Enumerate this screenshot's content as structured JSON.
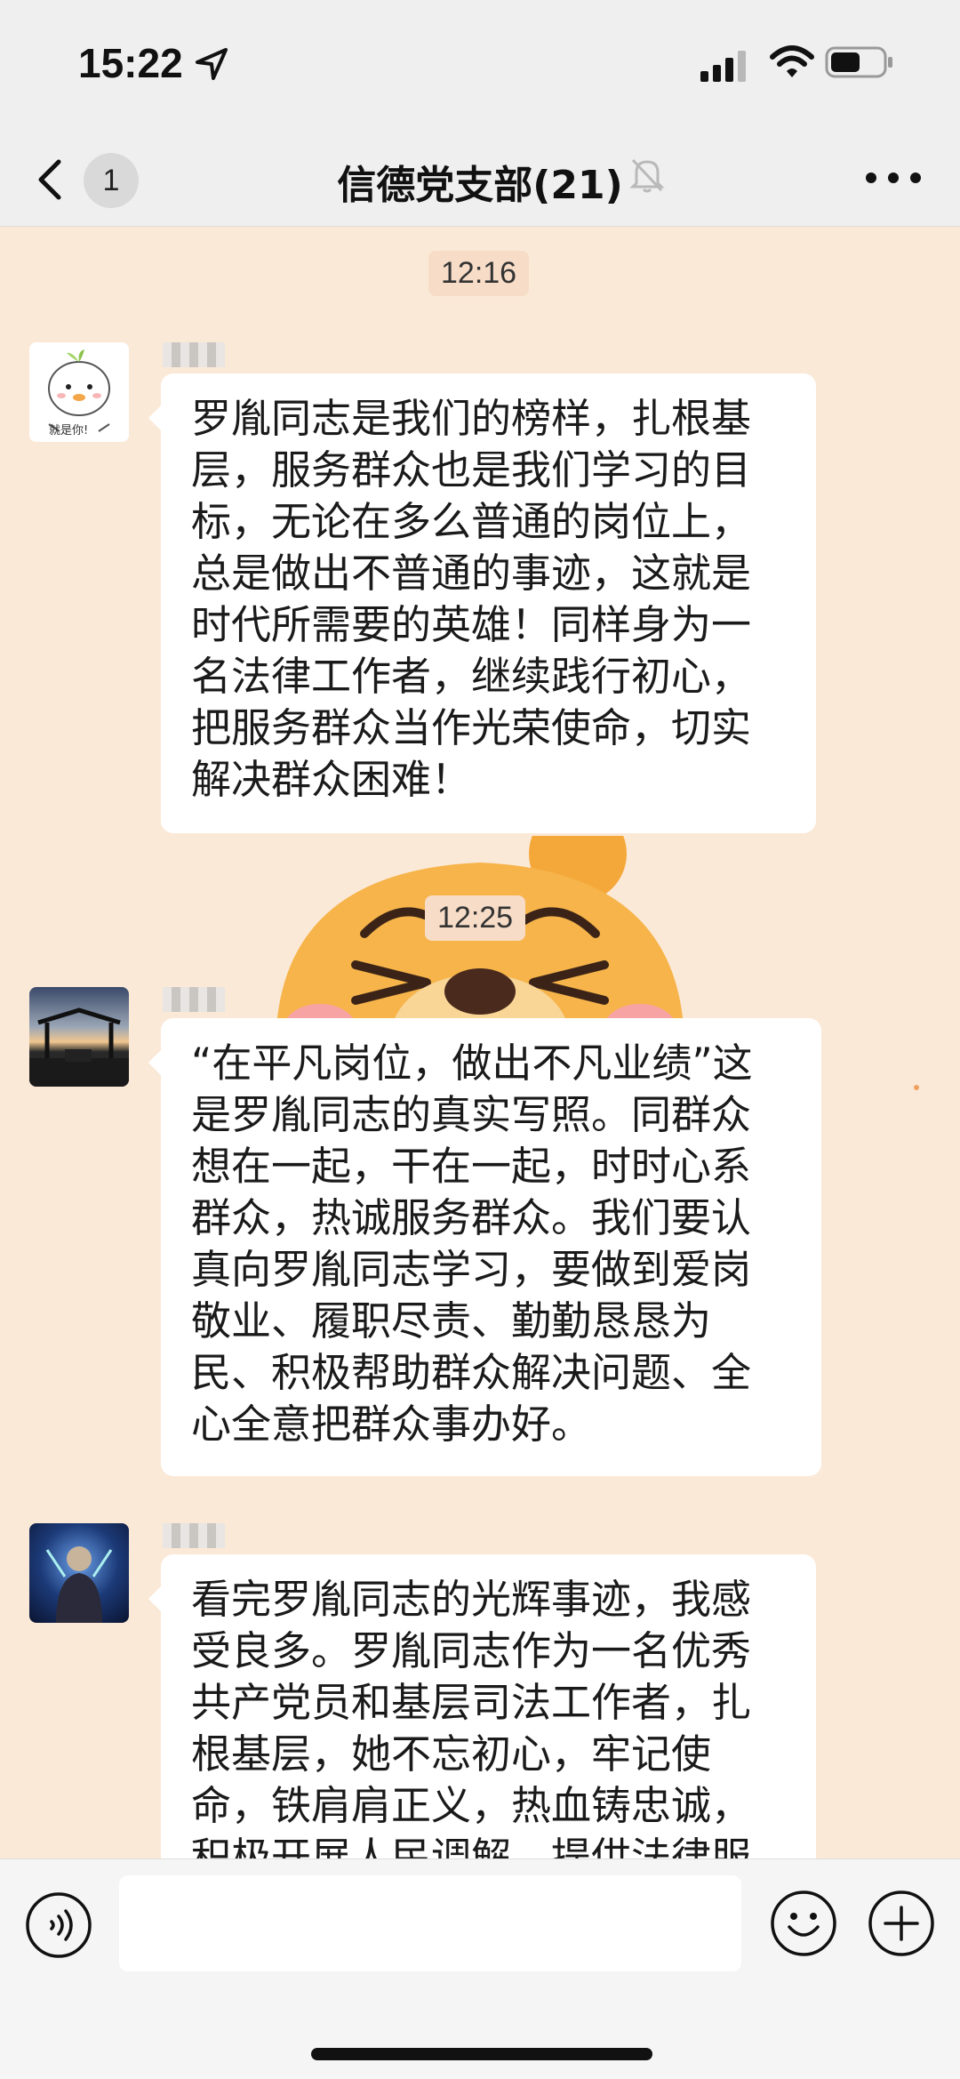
{
  "status_bar": {
    "time": "15:22",
    "icons": [
      "location-arrow-icon",
      "cellular-signal-icon",
      "wifi-icon",
      "battery-icon"
    ]
  },
  "header": {
    "unread_count": "1",
    "title": "信德党支部(21)",
    "icons": [
      "back-chevron-icon",
      "mute-bell-icon",
      "more-dots-icon"
    ]
  },
  "chat": {
    "messages": [
      {
        "time": "12:16",
        "sender_avatar": "cartoon-chick-avatar",
        "avatar_caption": "就是你!",
        "text": "罗胤同志是我们的榜样，扎根基\n层，服务群众也是我们学习的目\n标，无论在多么普通的岗位上，\n总是做出不普通的事迹，这就是\n时代所需要的英雄！同样身为一\n名法律工作者，继续践行初心，\n把服务群众当作光荣使命，切实\n解决群众困难！"
      },
      {
        "time": "12:25",
        "sender_avatar": "sunset-pavilion-avatar",
        "text": "“在平凡岗位，做出不凡业绩”这\n是罗胤同志的真实写照。同群众\n想在一起，干在一起，时时心系\n群众，热诚服务群众。我们要认\n真向罗胤同志学习，要做到爱岗\n敬业、履职尽责、勤勤恳恳为\n民、积极帮助群众解决问题、全\n心全意把群众事办好。"
      },
      {
        "sender_avatar": "warrior-character-avatar",
        "text": "看完罗胤同志的光辉事迹，我感\n受良多。罗胤同志作为一名优秀\n共产党员和基层司法工作者，扎\n根基层，她不忘初心，牢记使\n命，铁肩肩正义，热血铸忠诚，\n积极开展人民调解，提供法律服"
      }
    ],
    "sticker": "cartoon-bear-sticker"
  },
  "input_bar": {
    "placeholder": "",
    "icons": [
      "voice-icon",
      "emoji-icon",
      "plus-icon"
    ]
  },
  "colors": {
    "chat_background": "#fbe9d8",
    "bubble": "#ffffff",
    "header": "#efefef",
    "timestamp_bg": "#f7dcc7"
  }
}
